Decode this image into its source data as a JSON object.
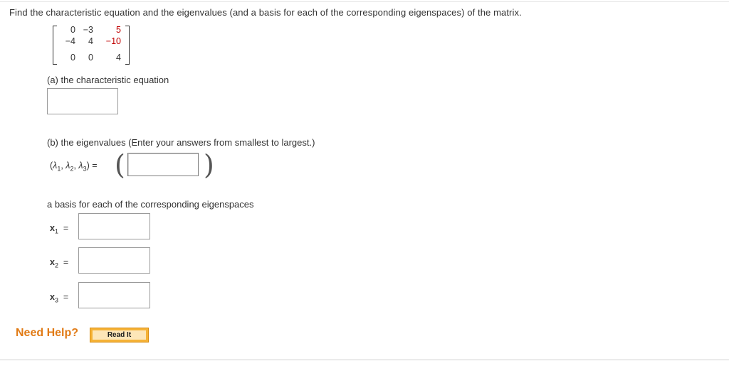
{
  "question": "Find the characteristic equation and the eigenvalues (and a basis for each of the corresponding eigenspaces) of the matrix.",
  "matrix": {
    "rows": [
      [
        "0",
        "−3",
        "5"
      ],
      [
        "−4",
        "4",
        "−10"
      ],
      [
        "0",
        "0",
        "4"
      ]
    ],
    "highlight_color": "#c00000"
  },
  "part_a": {
    "label": "(a) the characteristic equation",
    "value": ""
  },
  "part_b": {
    "label": "(b) the eigenvalues (Enter your answers from smallest to largest.)",
    "lambda_label": "(λ1, λ2, λ3) =",
    "value": ""
  },
  "basis": {
    "label": "a basis for each of the corresponding eigenspaces",
    "vectors": [
      {
        "name": "x",
        "sub": "1",
        "eq": "=",
        "value": ""
      },
      {
        "name": "x",
        "sub": "2",
        "eq": "=",
        "value": ""
      },
      {
        "name": "x",
        "sub": "3",
        "eq": "=",
        "value": ""
      }
    ]
  },
  "help": {
    "label": "Need Help?",
    "read_it": "Read It",
    "accent": "#e17b16"
  }
}
